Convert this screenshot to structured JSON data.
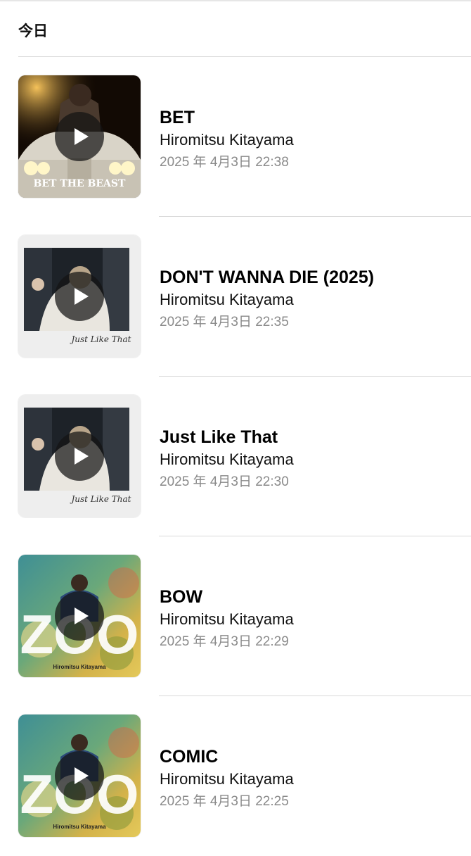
{
  "section": {
    "title": "今日"
  },
  "tracks": [
    {
      "title": "BET",
      "artist": "Hiromitsu Kitayama",
      "timestamp": "2025 年 4月3日 22:38",
      "artwork": "bet-the-beast",
      "artwork_text": "BET THE BEAST"
    },
    {
      "title": "DON'T WANNA DIE (2025)",
      "artist": "Hiromitsu Kitayama",
      "timestamp": "2025 年 4月3日 22:35",
      "artwork": "just-like-that",
      "artwork_text": "Just Like That"
    },
    {
      "title": "Just Like That",
      "artist": "Hiromitsu Kitayama",
      "timestamp": "2025 年 4月3日 22:30",
      "artwork": "just-like-that",
      "artwork_text": "Just Like That"
    },
    {
      "title": "BOW",
      "artist": "Hiromitsu Kitayama",
      "timestamp": "2025 年 4月3日 22:29",
      "artwork": "zoo",
      "artwork_text": "ZOO"
    },
    {
      "title": "COMIC",
      "artist": "Hiromitsu Kitayama",
      "timestamp": "2025 年 4月3日 22:25",
      "artwork": "zoo",
      "artwork_text": "ZOO"
    }
  ],
  "icons": {
    "play": "play-icon"
  }
}
